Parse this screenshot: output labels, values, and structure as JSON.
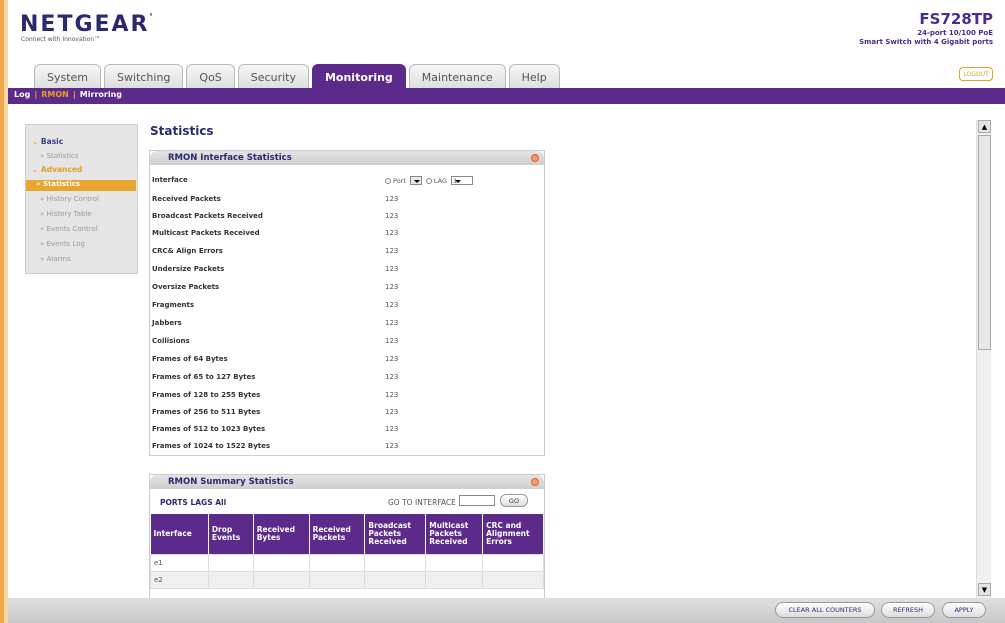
{
  "brand": {
    "logo": "NETGEAR",
    "tagline": "Connect with Innovation™",
    "model": "FS728TP",
    "model_desc_1": "24-port 10/100 PoE",
    "model_desc_2": "Smart Switch with 4 Gigabit ports"
  },
  "tabs": [
    "System",
    "Switching",
    "QoS",
    "Security",
    "Monitoring",
    "Maintenance",
    "Help"
  ],
  "active_tab": "Monitoring",
  "logout_label": "LOGOUT",
  "subnav": {
    "log": "Log",
    "rmon": "RMON",
    "mirroring": "Mirroring",
    "sep": "|"
  },
  "sidebar": {
    "basic": "Basic",
    "statistics_basic": "» Statistics",
    "advanced": "Advanced",
    "statistics_adv": "» Statistics",
    "history_control": "» History Control",
    "history_table": "» History Table",
    "events_control": "» Events Control",
    "events_log": "» Events Log",
    "alarms": "» Alarms"
  },
  "page_title": "Statistics",
  "iface_panel": {
    "title": "RMON Interface Statistics",
    "interface_label": "Interface",
    "port_label": "Port",
    "lag_label": "LAG",
    "lag_value": "1",
    "rows": [
      {
        "label": "Received Packets",
        "value": "123"
      },
      {
        "label": "Broadcast Packets Received",
        "value": "123"
      },
      {
        "label": "Multicast Packets Received",
        "value": "123"
      },
      {
        "label": "CRC& Align Errors",
        "value": "123"
      },
      {
        "label": "Undersize Packets",
        "value": "123"
      },
      {
        "label": "Oversize Packets",
        "value": "123"
      },
      {
        "label": "Fragments",
        "value": "123"
      },
      {
        "label": "Jabbers",
        "value": "123"
      },
      {
        "label": "Collisions",
        "value": "123"
      },
      {
        "label": "Frames of 64 Bytes",
        "value": "123"
      },
      {
        "label": "Frames of 65 to 127 Bytes",
        "value": "123"
      },
      {
        "label": "Frames of 128 to 255 Bytes",
        "value": "123"
      },
      {
        "label": "Frames of 256 to 511 Bytes",
        "value": "123"
      },
      {
        "label": "Frames of 512 to 1023 Bytes",
        "value": "123"
      },
      {
        "label": "Frames of 1024 to 1522 Bytes",
        "value": "123"
      }
    ]
  },
  "summary_panel": {
    "title": "RMON Summary Statistics",
    "ports_link": "PORTS",
    "lags_link": "LAGS",
    "all_link": "All",
    "goto_label": "GO TO INTERFACE",
    "go_button": "GO",
    "columns": [
      "Interface",
      "Drop Events",
      "Received Bytes",
      "Received Packets",
      "Broadcast Packets Received",
      "Multicast Packets Received",
      "CRC and Alignment Errors"
    ],
    "rows": [
      [
        "e1",
        "",
        "",
        "",
        "",
        "",
        ""
      ],
      [
        "e2",
        "",
        "",
        "",
        "",
        "",
        ""
      ]
    ]
  },
  "footer": {
    "clear": "CLEAR ALL COUNTERS",
    "refresh": "REFRESH",
    "apply": "APPLY"
  }
}
